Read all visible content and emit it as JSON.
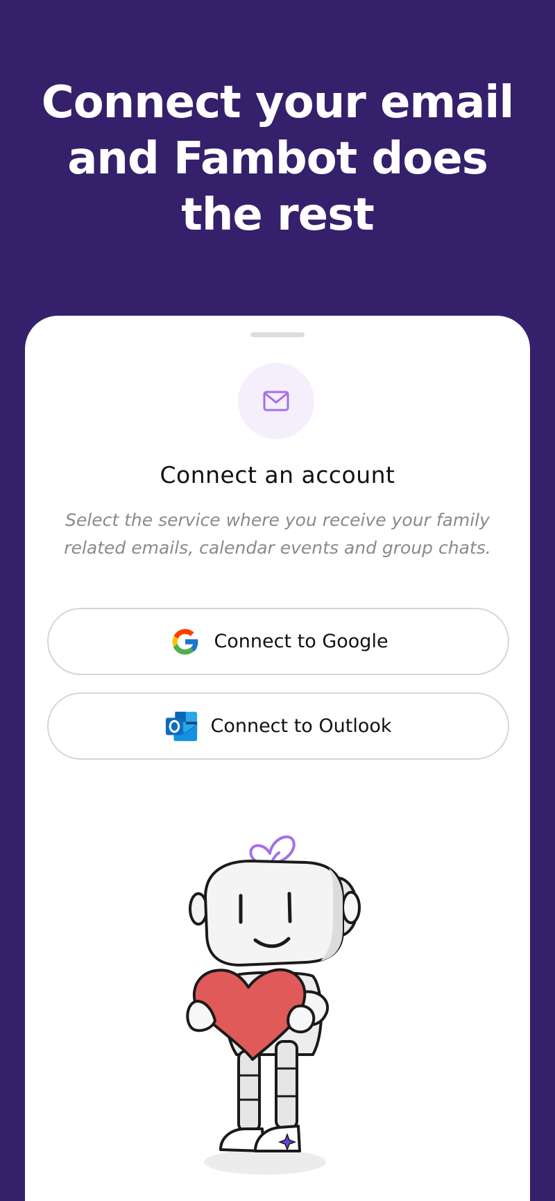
{
  "header": {
    "line1": "Connect your email",
    "line2": "and Fambot does",
    "line3": "the rest"
  },
  "sheet": {
    "icon": "mail-icon",
    "title": "Connect an account",
    "subtitle": "Select the service where you receive your family related emails, calendar events and group chats."
  },
  "buttons": {
    "google": {
      "label": "Connect to Google",
      "icon": "google-icon"
    },
    "outlook": {
      "label": "Connect to Outlook",
      "icon": "outlook-icon"
    }
  },
  "illustration": {
    "name": "robot-holding-heart"
  },
  "colors": {
    "background": "#35206b",
    "accent": "#a66ee8",
    "heart": "#e05a5a"
  }
}
